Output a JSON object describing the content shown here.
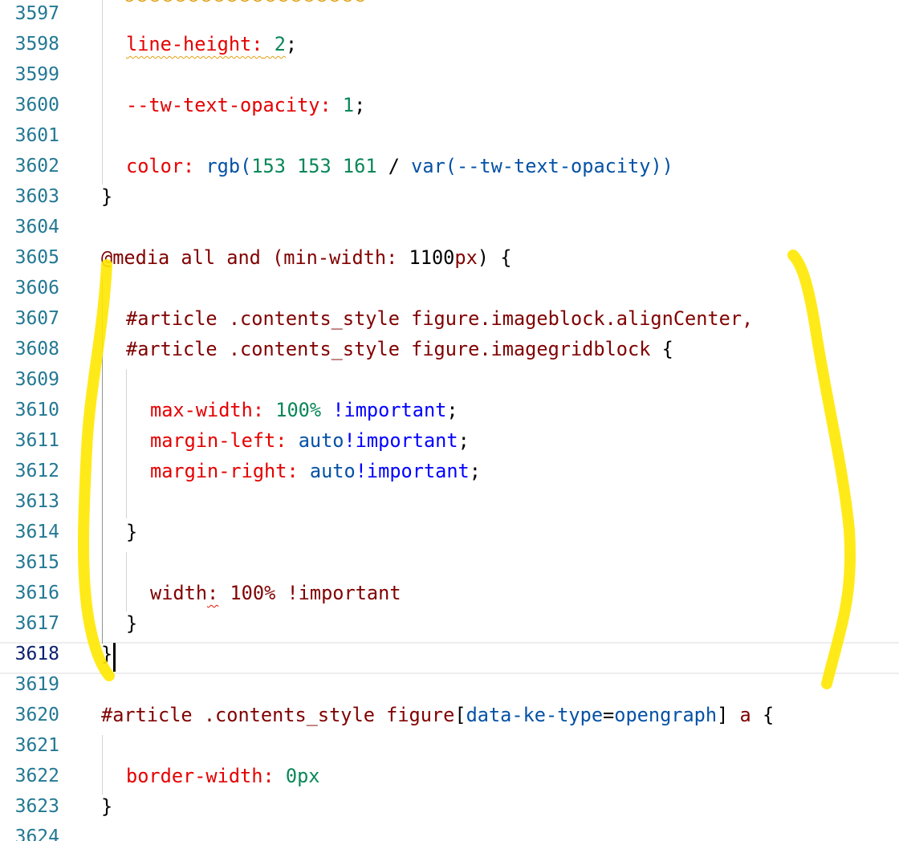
{
  "editor": {
    "language": "css",
    "active_line": 3618,
    "colors": {
      "selector": "#800000",
      "property": "#e50000",
      "number": "#098658",
      "keyword": "#0000ff",
      "line_number": "#237893",
      "highlight_marker": "#ffe800"
    },
    "lines": [
      {
        "n": "3597",
        "tokens": []
      },
      {
        "n": "3598",
        "tokens": [
          {
            "t": "line-height:",
            "c": "prop squiggle-warn"
          },
          {
            "t": " ",
            "c": "squiggle-warn"
          },
          {
            "t": "2",
            "c": "num squiggle-warn"
          },
          {
            "t": ";",
            "c": "brace"
          }
        ]
      },
      {
        "n": "3599",
        "tokens": []
      },
      {
        "n": "3600",
        "tokens": [
          {
            "t": "--tw-text-opacity:",
            "c": "prop"
          },
          {
            "t": " ",
            "c": ""
          },
          {
            "t": "1",
            "c": "num"
          },
          {
            "t": ";",
            "c": "brace"
          }
        ]
      },
      {
        "n": "3601",
        "tokens": []
      },
      {
        "n": "3602",
        "tokens": [
          {
            "t": "color:",
            "c": "prop"
          },
          {
            "t": " ",
            "c": ""
          },
          {
            "t": "rgb(",
            "c": "attr"
          },
          {
            "t": "153 153 161",
            "c": "num"
          },
          {
            "t": " / ",
            "c": "brace"
          },
          {
            "t": "var(--tw-text-opacity))",
            "c": "attr"
          }
        ]
      },
      {
        "n": "3603",
        "tokens": [
          {
            "t": "}",
            "c": "brace"
          }
        ]
      },
      {
        "n": "3604",
        "tokens": []
      },
      {
        "n": "3605",
        "tokens": [
          {
            "t": "@media all and (min-width: ",
            "c": "sel"
          },
          {
            "t": "1100",
            "c": "brace"
          },
          {
            "t": "px",
            "c": "sel"
          },
          {
            "t": ") {",
            "c": "brace"
          }
        ]
      },
      {
        "n": "3606",
        "tokens": []
      },
      {
        "n": "3607",
        "tokens": [
          {
            "t": "#article .contents_style figure.imageblock.alignCenter,",
            "c": "sel"
          }
        ]
      },
      {
        "n": "3608",
        "tokens": [
          {
            "t": "#article .contents_style figure.imagegridblock ",
            "c": "sel"
          },
          {
            "t": "{",
            "c": "brace"
          }
        ]
      },
      {
        "n": "3609",
        "tokens": []
      },
      {
        "n": "3610",
        "tokens": [
          {
            "t": "max-width:",
            "c": "prop"
          },
          {
            "t": " ",
            "c": ""
          },
          {
            "t": "100%",
            "c": "num"
          },
          {
            "t": " ",
            "c": ""
          },
          {
            "t": "!important",
            "c": "kw"
          },
          {
            "t": ";",
            "c": "brace"
          }
        ]
      },
      {
        "n": "3611",
        "tokens": [
          {
            "t": "margin-left:",
            "c": "prop"
          },
          {
            "t": " ",
            "c": ""
          },
          {
            "t": "auto",
            "c": "attr"
          },
          {
            "t": "!important",
            "c": "kw"
          },
          {
            "t": ";",
            "c": "brace"
          }
        ]
      },
      {
        "n": "3612",
        "tokens": [
          {
            "t": "margin-right:",
            "c": "prop"
          },
          {
            "t": " ",
            "c": ""
          },
          {
            "t": "auto",
            "c": "attr"
          },
          {
            "t": "!important",
            "c": "kw"
          },
          {
            "t": ";",
            "c": "brace"
          }
        ]
      },
      {
        "n": "3613",
        "tokens": []
      },
      {
        "n": "3614",
        "tokens": [
          {
            "t": "}",
            "c": "brace"
          }
        ]
      },
      {
        "n": "3615",
        "tokens": []
      },
      {
        "n": "3616",
        "tokens": [
          {
            "t": "width",
            "c": "sel"
          },
          {
            "t": ":",
            "c": "sel squiggle-err"
          },
          {
            "t": " 100% !important",
            "c": "sel"
          }
        ]
      },
      {
        "n": "3617",
        "tokens": [
          {
            "t": "}",
            "c": "brace"
          }
        ]
      },
      {
        "n": "3618",
        "tokens": [
          {
            "t": "}",
            "c": "brace"
          }
        ]
      },
      {
        "n": "3619",
        "tokens": []
      },
      {
        "n": "3620",
        "tokens": [
          {
            "t": "#article .contents_style figure",
            "c": "sel"
          },
          {
            "t": "[",
            "c": "brace"
          },
          {
            "t": "data-ke-type",
            "c": "attr"
          },
          {
            "t": "=",
            "c": "brace"
          },
          {
            "t": "opengraph",
            "c": "attr"
          },
          {
            "t": "] ",
            "c": "brace"
          },
          {
            "t": "a ",
            "c": "sel"
          },
          {
            "t": "{",
            "c": "brace"
          }
        ]
      },
      {
        "n": "3621",
        "tokens": []
      },
      {
        "n": "3622",
        "tokens": [
          {
            "t": "border-width:",
            "c": "prop"
          },
          {
            "t": " ",
            "c": ""
          },
          {
            "t": "0px",
            "c": "num"
          }
        ]
      },
      {
        "n": "3623",
        "tokens": [
          {
            "t": "}",
            "c": "brace"
          }
        ]
      },
      {
        "n": "3624",
        "tokens": []
      }
    ]
  }
}
